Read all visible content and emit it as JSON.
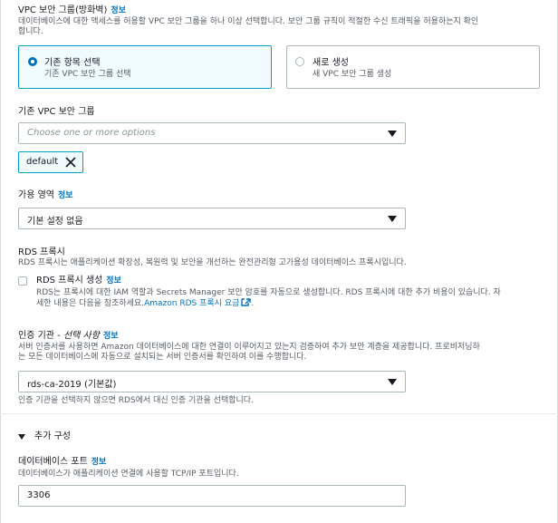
{
  "vpc_sg": {
    "label": "VPC 보안 그룹(방화벽)",
    "info": "정보",
    "desc_line1": "데이터베이스에 대한 액세스를 허용할 VPC 보안 그룹을 하나 이상 선택합니다. 보안 그룹 규칙이 적절한 수신 트래픽을 허용하는지 확인",
    "desc_line2": "합니다.",
    "options": [
      {
        "title": "기존 항목 선택",
        "sub": "기존 VPC 보안 그룹 선택",
        "selected": true
      },
      {
        "title": "새로 생성",
        "sub": "새 VPC 보안 그룹 생성",
        "selected": false
      }
    ]
  },
  "existing_sg": {
    "label": "기존 VPC 보안 그룹",
    "placeholder": "Choose one or more options",
    "tokens": [
      "default"
    ]
  },
  "az": {
    "label": "가용 영역",
    "info": "정보",
    "value": "기본 설정 없음"
  },
  "proxy": {
    "label": "RDS 프록시",
    "desc": "RDS 프록시는 애플리케이션 확장성, 복원력 및 보안을 개선하는 완전관리형 고가용성 데이터베이스 프록시입니다.",
    "checkbox_label": "RDS 프록시 생성",
    "info": "정보",
    "checkbox_desc_line1": "RDS는 프록시에 대한 IAM 역할과 Secrets Manager 보안 암호를 자동으로 생성합니다. RDS 프록시에 대한 추가 비용이 있습니다. 자",
    "checkbox_desc_line2_prefix": "세한 내용은 다음을 참조하세요.",
    "pricing_link": "Amazon RDS 프록시 요금",
    "checkbox_desc_line2_suffix": "."
  },
  "ca": {
    "label_main": "인증 기관 - ",
    "label_optional": "선택 사항",
    "info": "정보",
    "desc_line1": "서버 인증서를 사용하면 Amazon 데이터베이스에 대한 연결이 이루어지고 있는지 검증하여 추가 보안 계층을 제공합니다. 프로비저닝하",
    "desc_line2": "는 모든 데이터베이스에 자동으로 설치되는 서버 인증서를 확인하여 이를 수행합니다.",
    "value": "rds-ca-2019 (기본값)",
    "note": "인증 기관을 선택하지 않으면 RDS에서 대신 인증 기관을 선택합니다."
  },
  "additional": {
    "header": "추가 구성",
    "port_label": "데이터베이스 포트",
    "port_info": "정보",
    "port_desc": "데이터베이스가 애플리케이션 연결에 사용할 TCP/IP 포트입니다.",
    "port_value": "3306"
  },
  "colors": {
    "accent": "#0073bb",
    "selected_border": "#00a1c9",
    "selected_bg": "#f1faff"
  }
}
